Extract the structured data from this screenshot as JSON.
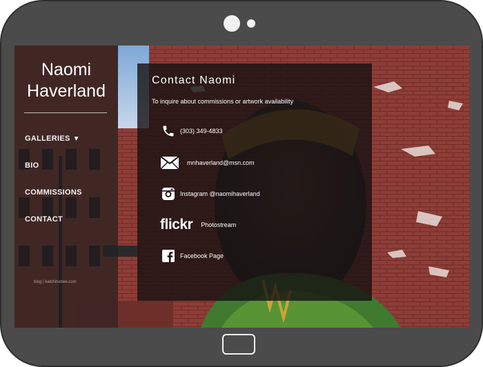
{
  "sidebar": {
    "title_line1": "Naomi",
    "title_line2": "Haverland",
    "nav": [
      {
        "label": "GALLERIES",
        "arrow": "▼"
      },
      {
        "label": "BIO"
      },
      {
        "label": "COMMISSIONS"
      },
      {
        "label": "CONTACT"
      }
    ],
    "footer": "blog | katchinabee.com"
  },
  "contact": {
    "title": "Contact Naomi",
    "subtitle": "To inquire about commissions or artwork availability",
    "items": [
      {
        "icon": "phone-icon",
        "label": "(303) 349-4833"
      },
      {
        "icon": "envelope-icon",
        "label": "mnhaverland@msn.com"
      },
      {
        "icon": "instagram-icon",
        "label": "Instagram @naomihaverland"
      },
      {
        "icon": "flickr-logo",
        "brand": "flickr",
        "label": "Photostream"
      },
      {
        "icon": "facebook-icon",
        "label": "Facebook Page"
      }
    ]
  },
  "colors": {
    "frame": "#4b4b4b",
    "panel": "#161212",
    "brick": "#8a3a35",
    "text": "#ffffff"
  }
}
